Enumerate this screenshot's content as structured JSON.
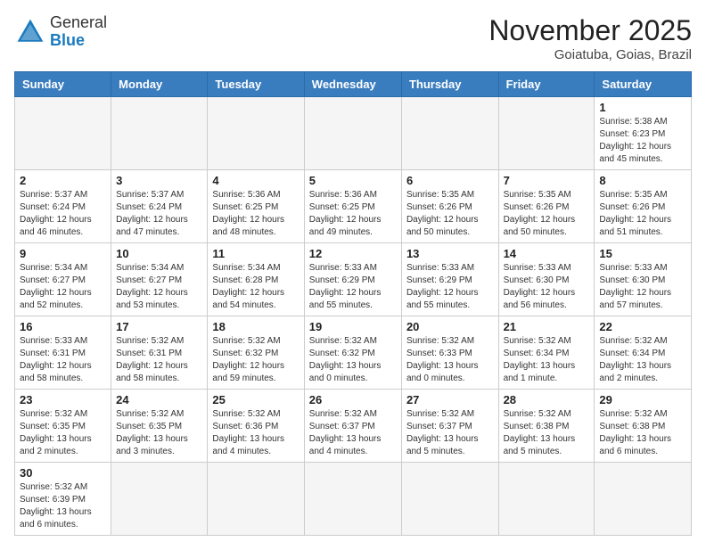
{
  "header": {
    "logo_general": "General",
    "logo_blue": "Blue",
    "month_title": "November 2025",
    "location": "Goiatuba, Goias, Brazil"
  },
  "days_of_week": [
    "Sunday",
    "Monday",
    "Tuesday",
    "Wednesday",
    "Thursday",
    "Friday",
    "Saturday"
  ],
  "weeks": [
    [
      {
        "day": "",
        "info": ""
      },
      {
        "day": "",
        "info": ""
      },
      {
        "day": "",
        "info": ""
      },
      {
        "day": "",
        "info": ""
      },
      {
        "day": "",
        "info": ""
      },
      {
        "day": "",
        "info": ""
      },
      {
        "day": "1",
        "info": "Sunrise: 5:38 AM\nSunset: 6:23 PM\nDaylight: 12 hours\nand 45 minutes."
      }
    ],
    [
      {
        "day": "2",
        "info": "Sunrise: 5:37 AM\nSunset: 6:24 PM\nDaylight: 12 hours\nand 46 minutes."
      },
      {
        "day": "3",
        "info": "Sunrise: 5:37 AM\nSunset: 6:24 PM\nDaylight: 12 hours\nand 47 minutes."
      },
      {
        "day": "4",
        "info": "Sunrise: 5:36 AM\nSunset: 6:25 PM\nDaylight: 12 hours\nand 48 minutes."
      },
      {
        "day": "5",
        "info": "Sunrise: 5:36 AM\nSunset: 6:25 PM\nDaylight: 12 hours\nand 49 minutes."
      },
      {
        "day": "6",
        "info": "Sunrise: 5:35 AM\nSunset: 6:26 PM\nDaylight: 12 hours\nand 50 minutes."
      },
      {
        "day": "7",
        "info": "Sunrise: 5:35 AM\nSunset: 6:26 PM\nDaylight: 12 hours\nand 50 minutes."
      },
      {
        "day": "8",
        "info": "Sunrise: 5:35 AM\nSunset: 6:26 PM\nDaylight: 12 hours\nand 51 minutes."
      }
    ],
    [
      {
        "day": "9",
        "info": "Sunrise: 5:34 AM\nSunset: 6:27 PM\nDaylight: 12 hours\nand 52 minutes."
      },
      {
        "day": "10",
        "info": "Sunrise: 5:34 AM\nSunset: 6:27 PM\nDaylight: 12 hours\nand 53 minutes."
      },
      {
        "day": "11",
        "info": "Sunrise: 5:34 AM\nSunset: 6:28 PM\nDaylight: 12 hours\nand 54 minutes."
      },
      {
        "day": "12",
        "info": "Sunrise: 5:33 AM\nSunset: 6:29 PM\nDaylight: 12 hours\nand 55 minutes."
      },
      {
        "day": "13",
        "info": "Sunrise: 5:33 AM\nSunset: 6:29 PM\nDaylight: 12 hours\nand 55 minutes."
      },
      {
        "day": "14",
        "info": "Sunrise: 5:33 AM\nSunset: 6:30 PM\nDaylight: 12 hours\nand 56 minutes."
      },
      {
        "day": "15",
        "info": "Sunrise: 5:33 AM\nSunset: 6:30 PM\nDaylight: 12 hours\nand 57 minutes."
      }
    ],
    [
      {
        "day": "16",
        "info": "Sunrise: 5:33 AM\nSunset: 6:31 PM\nDaylight: 12 hours\nand 58 minutes."
      },
      {
        "day": "17",
        "info": "Sunrise: 5:32 AM\nSunset: 6:31 PM\nDaylight: 12 hours\nand 58 minutes."
      },
      {
        "day": "18",
        "info": "Sunrise: 5:32 AM\nSunset: 6:32 PM\nDaylight: 12 hours\nand 59 minutes."
      },
      {
        "day": "19",
        "info": "Sunrise: 5:32 AM\nSunset: 6:32 PM\nDaylight: 13 hours\nand 0 minutes."
      },
      {
        "day": "20",
        "info": "Sunrise: 5:32 AM\nSunset: 6:33 PM\nDaylight: 13 hours\nand 0 minutes."
      },
      {
        "day": "21",
        "info": "Sunrise: 5:32 AM\nSunset: 6:34 PM\nDaylight: 13 hours\nand 1 minute."
      },
      {
        "day": "22",
        "info": "Sunrise: 5:32 AM\nSunset: 6:34 PM\nDaylight: 13 hours\nand 2 minutes."
      }
    ],
    [
      {
        "day": "23",
        "info": "Sunrise: 5:32 AM\nSunset: 6:35 PM\nDaylight: 13 hours\nand 2 minutes."
      },
      {
        "day": "24",
        "info": "Sunrise: 5:32 AM\nSunset: 6:35 PM\nDaylight: 13 hours\nand 3 minutes."
      },
      {
        "day": "25",
        "info": "Sunrise: 5:32 AM\nSunset: 6:36 PM\nDaylight: 13 hours\nand 4 minutes."
      },
      {
        "day": "26",
        "info": "Sunrise: 5:32 AM\nSunset: 6:37 PM\nDaylight: 13 hours\nand 4 minutes."
      },
      {
        "day": "27",
        "info": "Sunrise: 5:32 AM\nSunset: 6:37 PM\nDaylight: 13 hours\nand 5 minutes."
      },
      {
        "day": "28",
        "info": "Sunrise: 5:32 AM\nSunset: 6:38 PM\nDaylight: 13 hours\nand 5 minutes."
      },
      {
        "day": "29",
        "info": "Sunrise: 5:32 AM\nSunset: 6:38 PM\nDaylight: 13 hours\nand 6 minutes."
      }
    ],
    [
      {
        "day": "30",
        "info": "Sunrise: 5:32 AM\nSunset: 6:39 PM\nDaylight: 13 hours\nand 6 minutes."
      },
      {
        "day": "",
        "info": ""
      },
      {
        "day": "",
        "info": ""
      },
      {
        "day": "",
        "info": ""
      },
      {
        "day": "",
        "info": ""
      },
      {
        "day": "",
        "info": ""
      },
      {
        "day": "",
        "info": ""
      }
    ]
  ]
}
